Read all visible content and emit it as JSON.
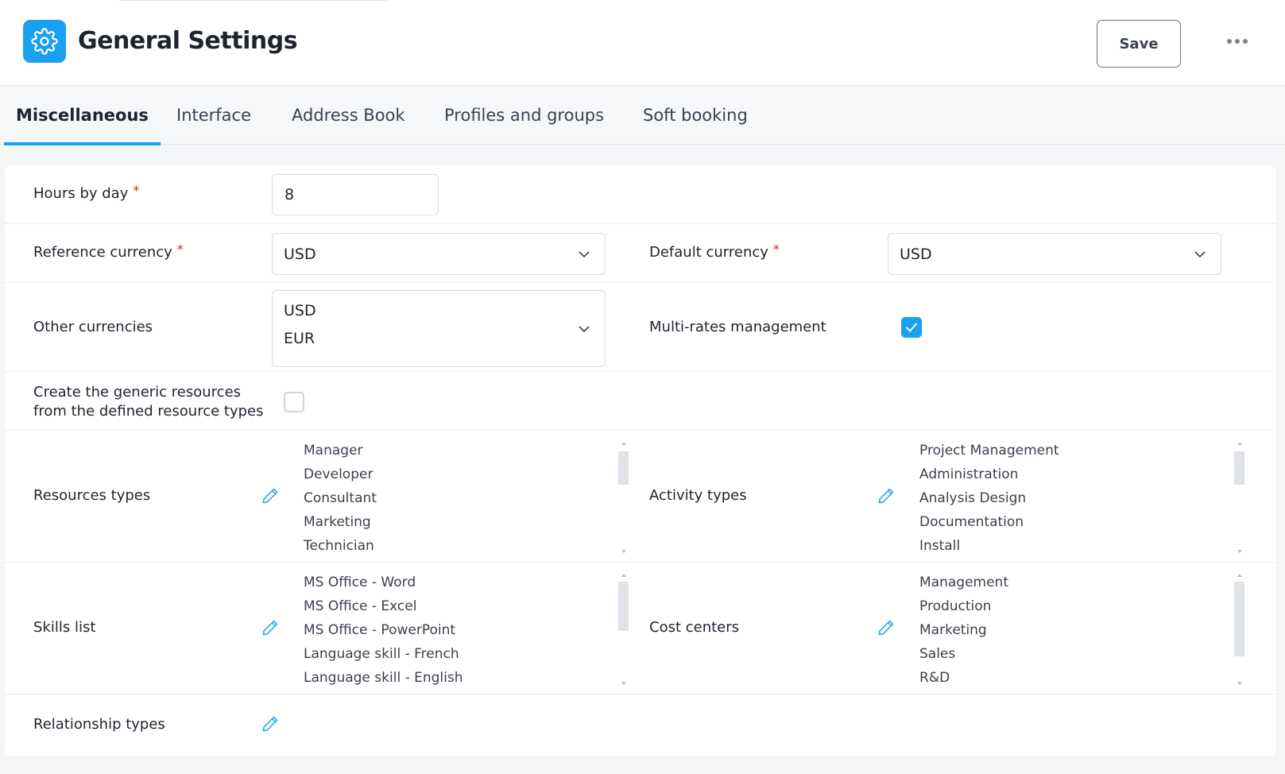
{
  "header": {
    "title": "General Settings",
    "app_icon": "gear-icon",
    "save_label": "Save",
    "more_icon": "more-horizontal-icon"
  },
  "tabs": [
    {
      "label": "Miscellaneous",
      "active": true
    },
    {
      "label": "Interface",
      "active": false
    },
    {
      "label": "Address Book",
      "active": false
    },
    {
      "label": "Profiles and groups",
      "active": false
    },
    {
      "label": "Soft booking",
      "active": false
    }
  ],
  "form": {
    "hours_by_day": {
      "label": "Hours by day",
      "required": "*",
      "value": "8"
    },
    "reference_currency": {
      "label": "Reference currency",
      "required": "*",
      "value": "USD"
    },
    "default_currency": {
      "label": "Default currency",
      "required": "*",
      "value": "USD"
    },
    "other_currencies": {
      "label": "Other currencies",
      "values": [
        "USD",
        "EUR"
      ]
    },
    "multi_rates": {
      "label": "Multi-rates management",
      "checked": true
    },
    "generic_resources": {
      "label": "Create the generic resources from the defined resource types",
      "checked": false
    },
    "resources_types": {
      "label": "Resources types",
      "items": [
        "Manager",
        "Developer",
        "Consultant",
        "Marketing",
        "Technician"
      ]
    },
    "activity_types": {
      "label": "Activity types",
      "items": [
        "Project Management",
        "Administration",
        "Analysis Design",
        "Documentation",
        "Install"
      ]
    },
    "skills_list": {
      "label": "Skills list",
      "items": [
        "MS Office - Word",
        "MS Office - Excel",
        "MS Office - PowerPoint",
        "Language skill - French",
        "Language skill - English"
      ]
    },
    "cost_centers": {
      "label": "Cost centers",
      "items": [
        "Management",
        "Production",
        "Marketing",
        "Sales",
        "R&D"
      ]
    },
    "relationship_types": {
      "label": "Relationship types"
    }
  },
  "colors": {
    "accent": "#1aa0f0",
    "required": "#e02424",
    "text": "#1f2330"
  }
}
